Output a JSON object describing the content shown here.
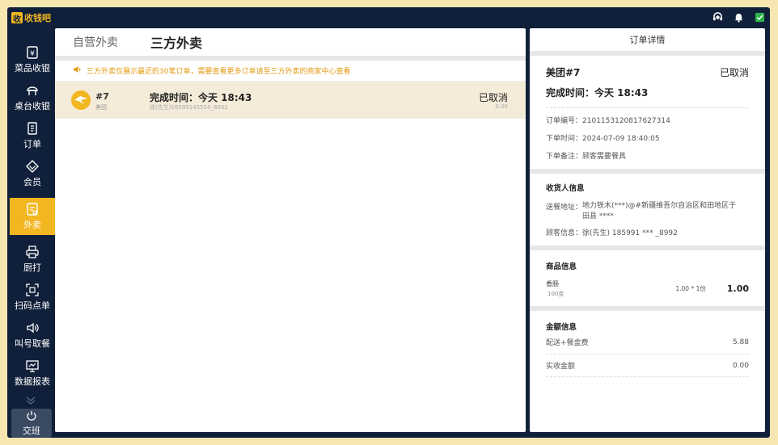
{
  "app": {
    "logo_mark": "收",
    "name": "收钱吧"
  },
  "sidebar": {
    "items": [
      {
        "label": "菜品收银"
      },
      {
        "label": "桌台收银"
      },
      {
        "label": "订单"
      },
      {
        "label": "会员"
      },
      {
        "label": "外卖"
      },
      {
        "label": "厨打"
      },
      {
        "label": "扫码点单"
      },
      {
        "label": "叫号取餐"
      },
      {
        "label": "数据报表"
      }
    ],
    "shift_label": "交班"
  },
  "tabs": [
    {
      "label": "自营外卖"
    },
    {
      "label": "三方外卖"
    }
  ],
  "notice": "三方外卖仅展示最近的30笔订单，需要查看更多订单请至三方外卖的商家中心查看",
  "orders": [
    {
      "number": "#7",
      "source": "美团",
      "time": "完成时间：今天 18:43",
      "customer": "徐(先生)18599145554_8992",
      "status": "已取消",
      "amount": "0.00"
    }
  ],
  "detail": {
    "header": "订单详情",
    "title": "美团#7",
    "status": "已取消",
    "complete_time": "完成时间：今天 18:43",
    "order_no_label": "订单编号：",
    "order_no": "2101153120817627314",
    "order_time_label": "下单时间：",
    "order_time": "2024-07-09 18:40:05",
    "note_label": "下单备注：",
    "note": "顾客需要餐具",
    "receiver_title": "收货人信息",
    "address_label": "送餐地址：",
    "address_line1": "地力铁木(***)@#新疆维吾尔自治区和田地区于",
    "address_line2": "田县 ****",
    "customer_label": "顾客信息：",
    "customer": "徐(先生) 185991 *** _8992",
    "goods_title": "商品信息",
    "goods": [
      {
        "name": "香肠",
        "spec": "100克",
        "qty": "1.00 * 1份",
        "price": "1.00"
      }
    ],
    "amount_title": "金额信息",
    "delivery_label": "配送+餐盒费",
    "delivery_value": "5.88",
    "actual_label": "实收金额",
    "actual_value": "0.00"
  },
  "colors": {
    "accent": "#f2b620",
    "frame": "#10203a",
    "border": "#f6e6b2",
    "notice": "#e39a12",
    "row_highlight": "#f5ebd9"
  }
}
